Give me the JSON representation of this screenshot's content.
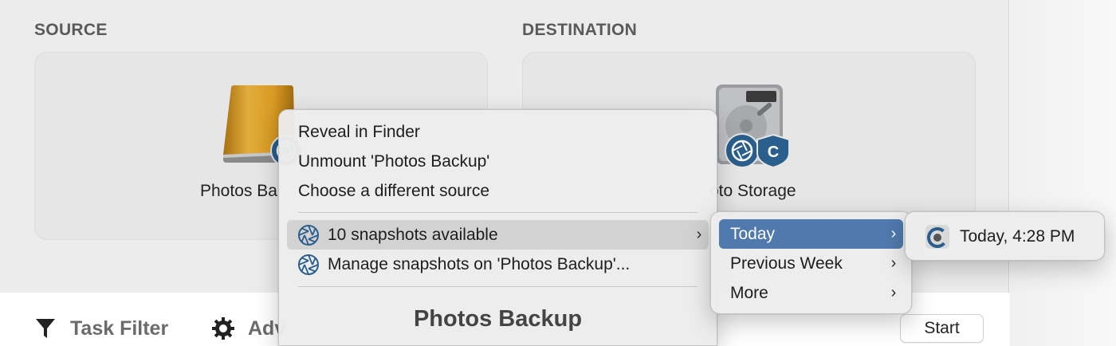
{
  "source": {
    "label": "SOURCE",
    "volume_name": "Photos Ba"
  },
  "destination": {
    "label": "DESTINATION",
    "volume_name": "oto Storage"
  },
  "footer": {
    "task_filter": "Task Filter",
    "advanced": "Adv",
    "start": "Start"
  },
  "context_menu": {
    "items": [
      {
        "label": "Reveal in Finder"
      },
      {
        "label": "Unmount 'Photos Backup'"
      },
      {
        "label": "Choose a different source"
      },
      {
        "label": "10 snapshots available",
        "icon": "snapshot-aperture-icon",
        "submenu": true,
        "highlighted": true
      },
      {
        "label": "Manage snapshots on 'Photos Backup'...",
        "icon": "snapshot-aperture-icon"
      }
    ],
    "title": "Photos Backup"
  },
  "snapshots_submenu": {
    "items": [
      {
        "label": "Today",
        "submenu": true,
        "selected": true
      },
      {
        "label": "Previous Week",
        "submenu": true
      },
      {
        "label": "More",
        "submenu": true
      }
    ]
  },
  "today_submenu": {
    "items": [
      {
        "label": "Today, 4:28 PM",
        "icon": "ccc-snapshot-icon"
      }
    ]
  },
  "colors": {
    "highlight_blue": "#5079ad",
    "highlight_grey": "#d2d2d2",
    "aperture_blue": "#2a5e8c",
    "drive_gold": "#d8a02a"
  }
}
